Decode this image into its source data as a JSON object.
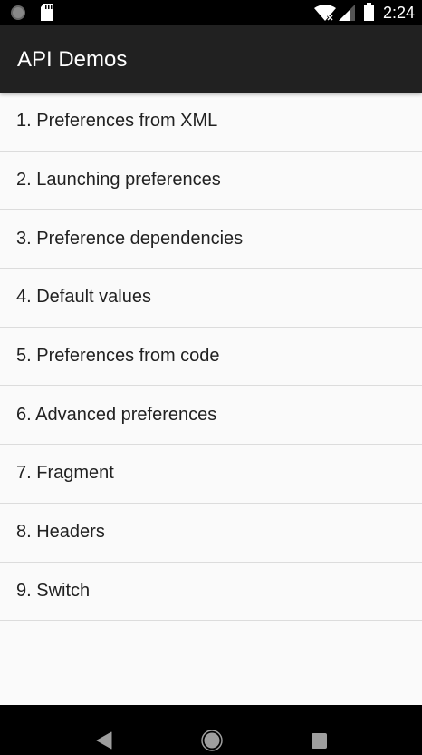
{
  "status_bar": {
    "time": "2:24",
    "icons": [
      "sync-icon",
      "sd-card-icon",
      "wifi-no-internet-icon",
      "cell-signal-icon",
      "battery-icon"
    ]
  },
  "app_bar": {
    "title": "API Demos"
  },
  "list": {
    "items": [
      {
        "label": "1. Preferences from XML"
      },
      {
        "label": "2. Launching preferences"
      },
      {
        "label": "3. Preference dependencies"
      },
      {
        "label": "4. Default values"
      },
      {
        "label": "5. Preferences from code"
      },
      {
        "label": "6. Advanced preferences"
      },
      {
        "label": "7. Fragment"
      },
      {
        "label": "8. Headers"
      },
      {
        "label": "9. Switch"
      }
    ]
  },
  "nav_bar": {
    "buttons": [
      "back-icon",
      "home-icon",
      "recents-icon"
    ]
  }
}
